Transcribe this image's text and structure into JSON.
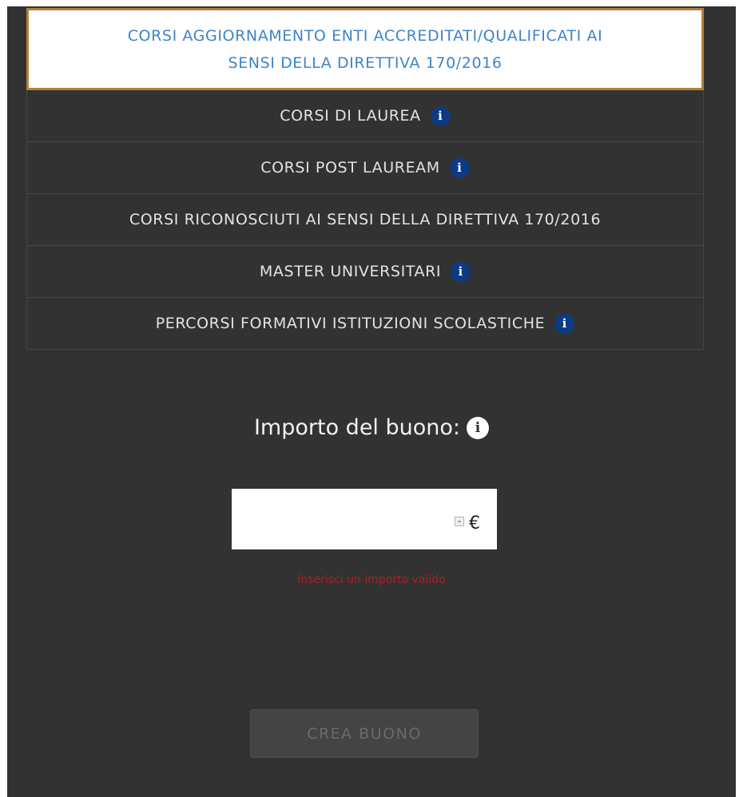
{
  "course_types": [
    {
      "line1": "CORSI AGGIORNAMENTO ENTI ACCREDITATI/QUALIFICATI AI",
      "line2": "SENSI DELLA DIRETTIVA 170/2016",
      "selected": true,
      "has_info": false
    },
    {
      "label": "CORSI DI LAUREA",
      "selected": false,
      "has_info": true
    },
    {
      "label": "CORSI POST LAUREAM",
      "selected": false,
      "has_info": true
    },
    {
      "label": "CORSI RICONOSCIUTI AI SENSI DELLA DIRETTIVA 170/2016",
      "selected": false,
      "has_info": false
    },
    {
      "label": "MASTER UNIVERSITARI",
      "selected": false,
      "has_info": true
    },
    {
      "label": "PERCORSI FORMATIVI ISTITUZIONI SCOLASTICHE",
      "selected": false,
      "has_info": true
    }
  ],
  "info_glyph": "i",
  "amount": {
    "label": "Importo del buono:",
    "value": "",
    "currency": "€",
    "error": "Inserisci un importo valido"
  },
  "create_button_label": "CREA BUONO",
  "colors": {
    "panel_bg": "#323232",
    "selected_border": "#b1813a",
    "selected_text": "#3f84c7",
    "info_badge": "#0d3a85",
    "error": "#b51c1c"
  }
}
